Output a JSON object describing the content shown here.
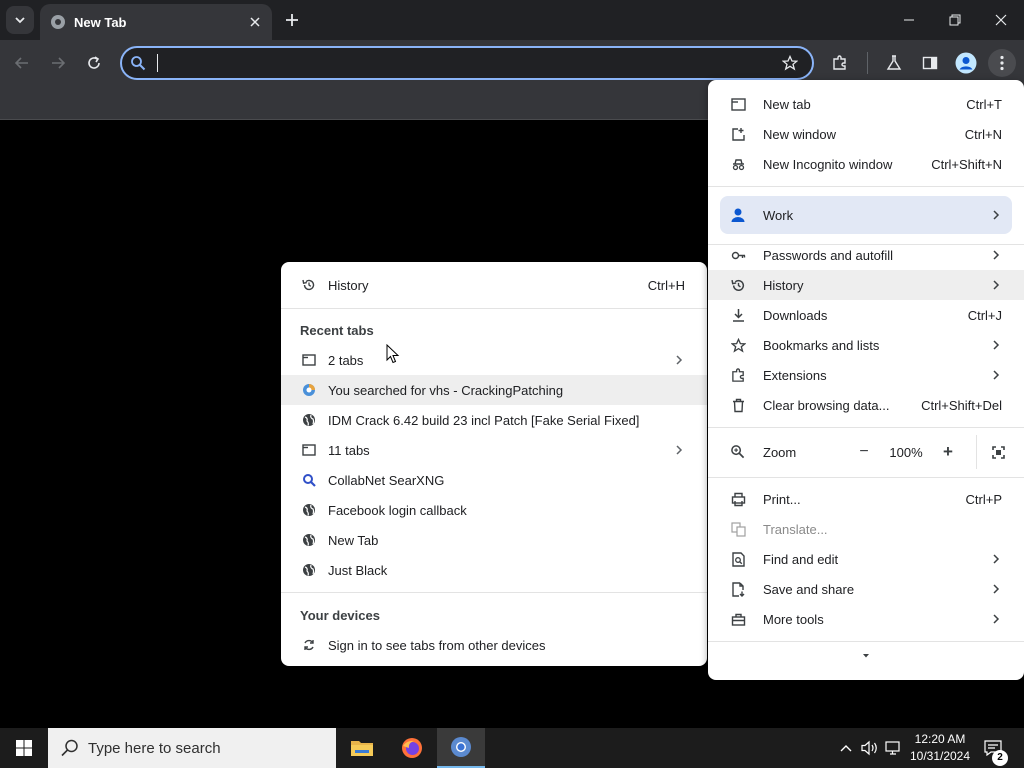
{
  "browser": {
    "tab": {
      "title": "New Tab"
    },
    "omnibox": {
      "value": "",
      "placeholder": ""
    }
  },
  "main_menu": {
    "items": [
      {
        "label": "New tab",
        "shortcut": "Ctrl+T",
        "icon": "new-tab-icon"
      },
      {
        "label": "New window",
        "shortcut": "Ctrl+N",
        "icon": "new-window-icon"
      },
      {
        "label": "New Incognito window",
        "shortcut": "Ctrl+Shift+N",
        "icon": "incognito-icon"
      }
    ],
    "profile": {
      "label": "Work",
      "icon": "person-icon"
    },
    "items2": [
      {
        "label": "Passwords and autofill",
        "icon": "key-icon"
      },
      {
        "label": "History",
        "icon": "history-icon"
      },
      {
        "label": "Downloads",
        "shortcut": "Ctrl+J",
        "icon": "download-icon"
      },
      {
        "label": "Bookmarks and lists",
        "icon": "star-icon"
      },
      {
        "label": "Extensions",
        "icon": "puzzle-icon"
      },
      {
        "label": "Clear browsing data...",
        "shortcut": "Ctrl+Shift+Del",
        "icon": "trash-icon"
      }
    ],
    "zoom": {
      "label": "Zoom",
      "value": "100%",
      "minus": "−",
      "plus": "+"
    },
    "items3": [
      {
        "label": "Print...",
        "shortcut": "Ctrl+P",
        "icon": "print-icon"
      },
      {
        "label": "Translate...",
        "icon": "translate-icon",
        "disabled": true
      },
      {
        "label": "Find and edit",
        "icon": "find-icon"
      },
      {
        "label": "Save and share",
        "icon": "save-icon"
      },
      {
        "label": "More tools",
        "icon": "toolbox-icon"
      }
    ]
  },
  "history_menu": {
    "history": {
      "label": "History",
      "shortcut": "Ctrl+H"
    },
    "recent_header": "Recent tabs",
    "recent": [
      {
        "label": "2 tabs",
        "icon": "window-icon",
        "submenu": true
      },
      {
        "label": "You searched for vhs - CrackingPatching",
        "icon": "site-favicon"
      },
      {
        "label": "IDM Crack 6.42 build 23 incl Patch [Fake Serial Fixed]",
        "icon": "globe-icon"
      },
      {
        "label": "11 tabs",
        "icon": "window-icon",
        "submenu": true
      },
      {
        "label": "CollabNet SearXNG",
        "icon": "search-icon"
      },
      {
        "label": "Facebook login callback",
        "icon": "globe-icon"
      },
      {
        "label": "New Tab",
        "icon": "globe-icon"
      },
      {
        "label": "Just Black",
        "icon": "globe-icon"
      }
    ],
    "devices_header": "Your devices",
    "devices": {
      "label": "Sign in to see tabs from other devices",
      "icon": "sync-icon"
    }
  },
  "taskbar": {
    "search_placeholder": "Type here to search",
    "time": "12:20 AM",
    "date": "10/31/2024",
    "notifications": "2"
  }
}
